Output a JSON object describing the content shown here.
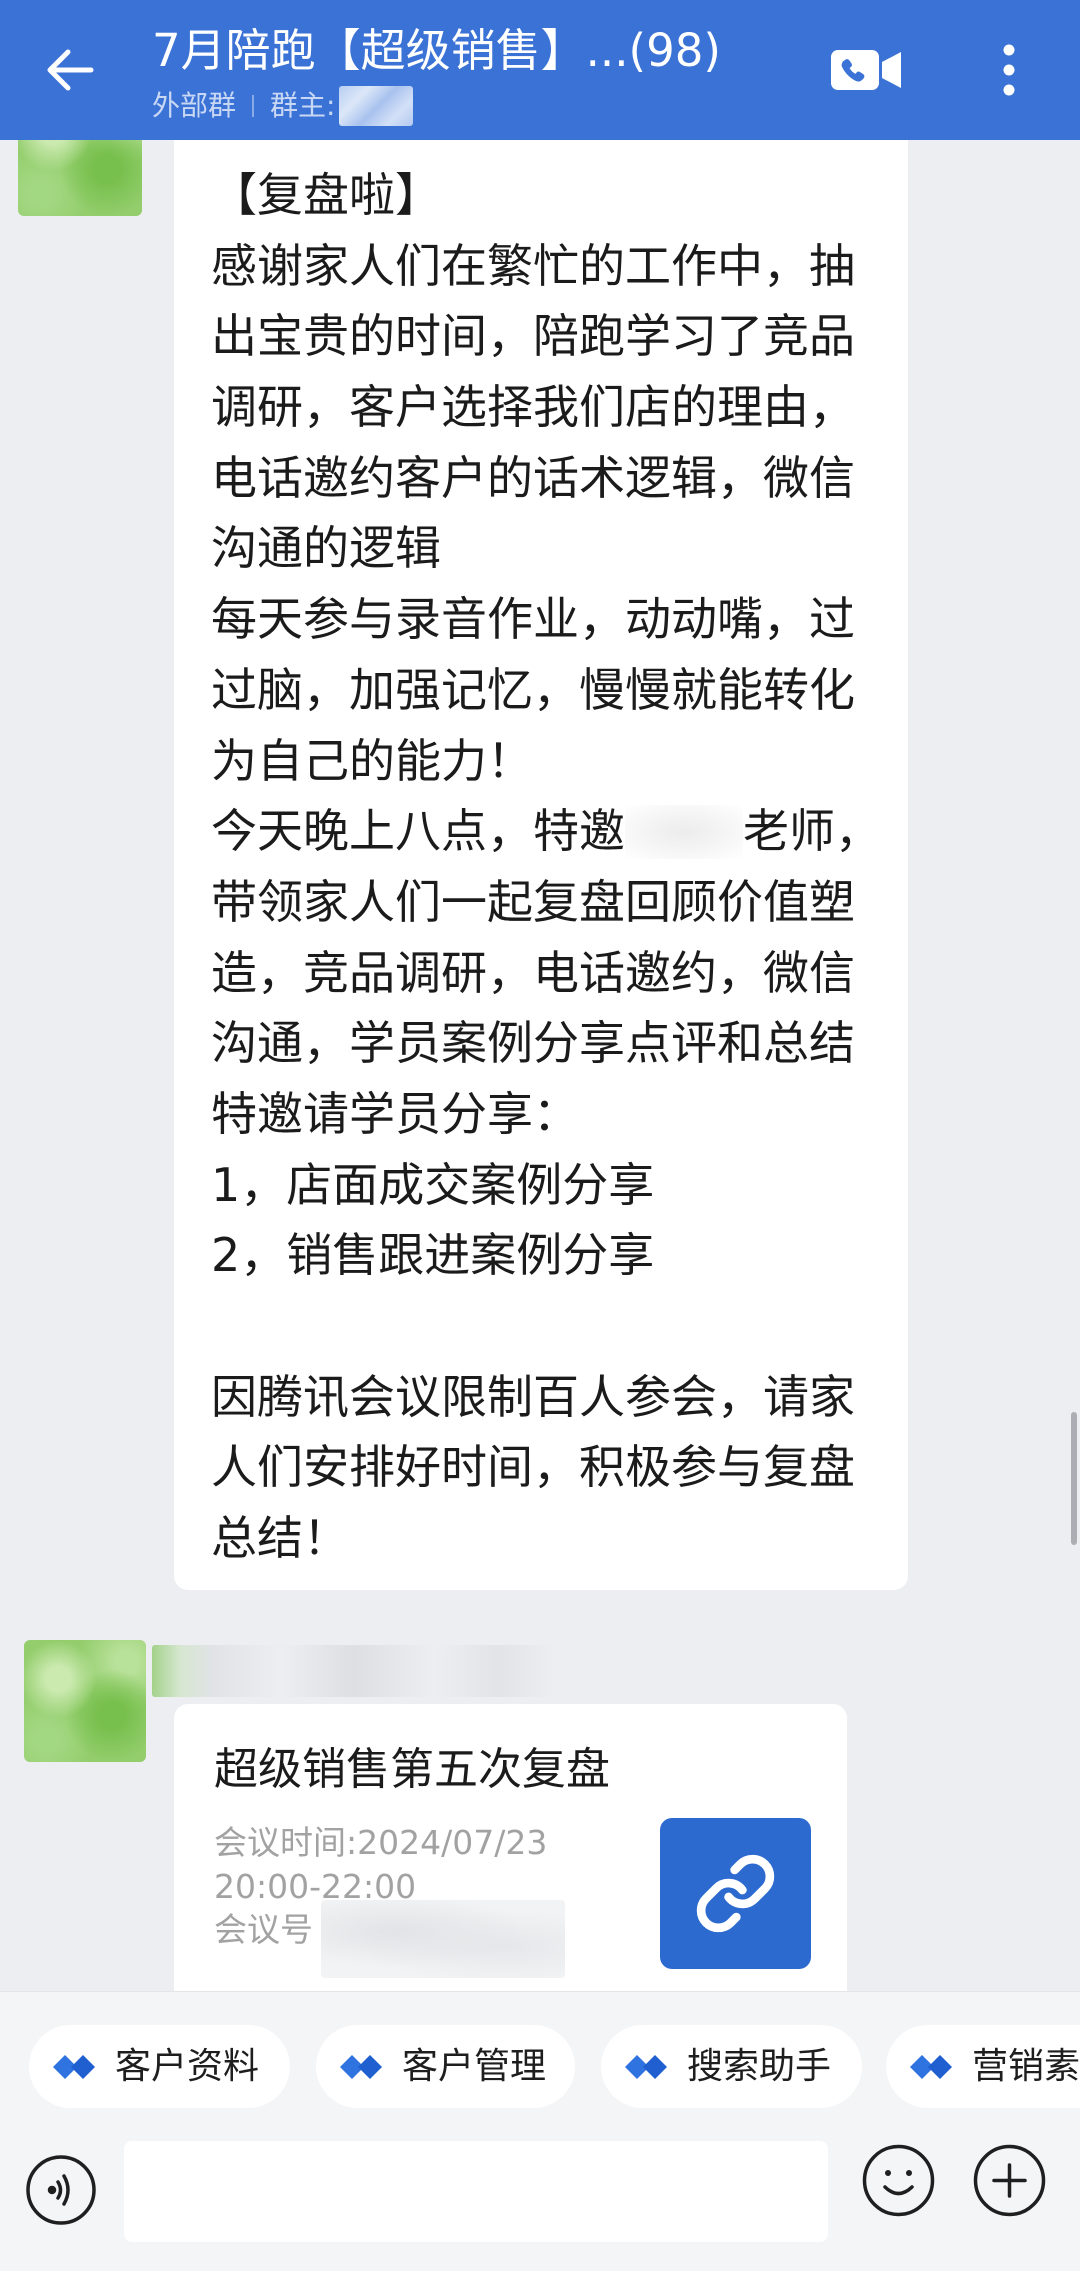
{
  "header": {
    "title": "7月陪跑【超级销售】...(98)",
    "group_type": "外部群",
    "owner_label": "群主:",
    "icons": {
      "back": "arrow-left-icon",
      "video_call": "video-call-icon",
      "more": "more-vertical-icon"
    }
  },
  "chat": {
    "announcement": {
      "lines": [
        "【复盘啦】",
        "感谢家人们在繁忙的工作中，抽",
        "出宝贵的时间，陪跑学习了竞品",
        "调研，客户选择我们店的理由，",
        "电话邀约客户的话术逻辑，微信",
        "沟通的逻辑",
        "每天参与录音作业，动动嘴，过",
        "过脑，加强记忆，慢慢就能转化",
        "为自己的能力！"
      ],
      "invite_before": "今天晚上八点，特邀",
      "invite_after": "老师，",
      "lines_after_invite": [
        "带领家人们一起复盘回顾价值塑",
        "造，竞品调研，电话邀约，微信",
        "沟通，学员案例分享点评和总结",
        "特邀请学员分享：",
        "1，店面成交案例分享",
        "2，销售跟进案例分享"
      ],
      "closing_lines": [
        "因腾讯会议限制百人参会，请家",
        "人们安排好时间，积极参与复盘",
        "总结！"
      ]
    },
    "meeting_card": {
      "title": "超级销售第五次复盘",
      "time_label": "会议时间:2024/07/23",
      "time_range": "20:00-22:00",
      "meeting_id_label": "会议号",
      "icon": "link-icon"
    }
  },
  "toolbar": {
    "shortcuts": [
      {
        "label": "客户资料",
        "icon": "workbench-app-icon"
      },
      {
        "label": "客户管理",
        "icon": "workbench-app-icon"
      },
      {
        "label": "搜索助手",
        "icon": "workbench-app-icon"
      },
      {
        "label": "营销素",
        "icon": "workbench-app-icon"
      }
    ],
    "message_input": {
      "value": ""
    },
    "icons": {
      "voice": "voice-icon",
      "emoji": "emoji-icon",
      "more": "plus-icon"
    }
  },
  "colors": {
    "header": "#3a72d6",
    "chat_background": "#eceef2",
    "accent": "#2d6ad0",
    "toolbar_background": "#f4f5f7"
  }
}
